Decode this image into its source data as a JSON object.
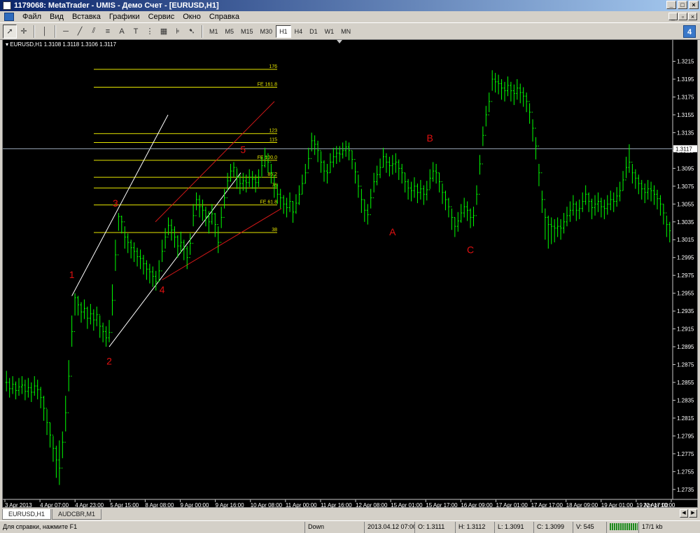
{
  "window": {
    "title": "1179068: MetaTrader - UMIS - Демо Счет - [EURUSD,H1]"
  },
  "menu": [
    "Файл",
    "Вид",
    "Вставка",
    "Графики",
    "Сервис",
    "Окно",
    "Справка"
  ],
  "toolbar": {
    "tools": [
      "cursor-icon",
      "crosshair-icon",
      "vertical-line-icon",
      "horizontal-line-icon",
      "trendline-icon",
      "equidistant-channel-icon",
      "text-icon",
      "text-label-icon",
      "fibonacci-icon",
      "fibonacci-fan-icon",
      "arrows-icon"
    ],
    "timeframes": [
      "M1",
      "M5",
      "M15",
      "M30",
      "H1",
      "H4",
      "D1",
      "W1",
      "MN"
    ],
    "active_timeframe": "H1",
    "text_tool_label": "A",
    "label_tool_label": "T",
    "help_label": "4"
  },
  "chart_data": {
    "type": "candlestick",
    "header": "EURUSD,H1  1.3108 1.3118 1.3106 1.3117",
    "background": "#000000",
    "bar_color": "#00ff00",
    "current_price": "1.3117",
    "y_ticks": [
      "1.3215",
      "1.3195",
      "1.3175",
      "1.3155",
      "1.3135",
      "1.3115",
      "1.3095",
      "1.3075",
      "1.3055",
      "1.3035",
      "1.3015",
      "1.2995",
      "1.2975",
      "1.2955",
      "1.2935",
      "1.2915",
      "1.2895",
      "1.2875",
      "1.2855",
      "1.2835",
      "1.2815",
      "1.2795",
      "1.2775",
      "1.2755",
      "1.2735"
    ],
    "y_range": [
      1.2727,
      1.3228
    ],
    "x_ticks": [
      "3 Apr 2013",
      "4 Apr 07:00",
      "4 Apr 23:00",
      "5 Apr 15:00",
      "8 Apr 08:00",
      "9 Apr 00:00",
      "9 Apr 16:00",
      "10 Apr 08:00",
      "11 Apr 00:00",
      "11 Apr 16:00",
      "12 Apr 08:00",
      "15 Apr 01:00",
      "15 Apr 17:00",
      "16 Apr 09:00",
      "17 Apr 01:00",
      "17 Apr 17:00",
      "18 Apr 09:00",
      "19 Apr 01:00",
      "19 Apr 17:00",
      "22 Apr 10:00"
    ],
    "closes": [
      1.2855,
      1.2848,
      1.2853,
      1.2846,
      1.285,
      1.2852,
      1.2845,
      1.2849,
      1.2844,
      1.2851,
      1.2847,
      1.2838,
      1.2826,
      1.281,
      1.2796,
      1.2781,
      1.2768,
      1.2759,
      1.2788,
      1.2821,
      1.2862,
      1.2912,
      1.295,
      1.2942,
      1.2934,
      1.2938,
      1.2927,
      1.2932,
      1.2925,
      1.2931,
      1.2918,
      1.2912,
      1.2905,
      1.2911,
      1.2947,
      1.2998,
      1.3041,
      1.3035,
      1.3018,
      1.3012,
      1.3006,
      1.3002,
      1.2996,
      1.2994,
      1.2988,
      1.2982,
      1.2979,
      1.2974,
      1.2968,
      1.298,
      1.3002,
      1.3018,
      1.3031,
      1.3026,
      1.3018,
      1.3008,
      1.3012,
      1.3005,
      1.2995,
      1.3011,
      1.3042,
      1.306,
      1.3052,
      1.3048,
      1.3041,
      1.3035,
      1.3044,
      1.3032,
      1.3012,
      1.304,
      1.3062,
      1.3081,
      1.3092,
      1.3096,
      1.3085,
      1.3078,
      1.3081,
      1.3079,
      1.3085,
      1.3083,
      1.3079,
      1.3085,
      1.3098,
      1.3108,
      1.3102,
      1.309,
      1.3075,
      1.3066,
      1.3062,
      1.3055,
      1.3051,
      1.3058,
      1.3046,
      1.3056,
      1.3066,
      1.3078,
      1.309,
      1.3106,
      1.3126,
      1.3122,
      1.3115,
      1.3102,
      1.3092,
      1.309,
      1.3102,
      1.3108,
      1.3112,
      1.3111,
      1.3115,
      1.3119,
      1.3115,
      1.3105,
      1.3091,
      1.3075,
      1.306,
      1.3048,
      1.3043,
      1.3062,
      1.308,
      1.3088,
      1.3096,
      1.3108,
      1.3102,
      1.3098,
      1.31,
      1.3102,
      1.3095,
      1.309,
      1.308,
      1.3073,
      1.307,
      1.3075,
      1.3068,
      1.3072,
      1.3066,
      1.3071,
      1.3084,
      1.3092,
      1.309,
      1.308,
      1.3068,
      1.306,
      1.3052,
      1.304,
      1.303,
      1.3036,
      1.3045,
      1.3052,
      1.3048,
      1.304,
      1.3042,
      1.3066,
      1.31,
      1.3132,
      1.3155,
      1.317,
      1.3195,
      1.3192,
      1.319,
      1.3185,
      1.3182,
      1.3188,
      1.3182,
      1.3179,
      1.3185,
      1.318,
      1.3176,
      1.317,
      1.3158,
      1.314,
      1.312,
      1.309,
      1.306,
      1.304,
      1.3032,
      1.303,
      1.3028,
      1.303,
      1.3028,
      1.3035,
      1.3042,
      1.3048,
      1.3055,
      1.3048,
      1.305,
      1.3058,
      1.3066,
      1.3058,
      1.3051,
      1.3055,
      1.3058,
      1.3052,
      1.305,
      1.3055,
      1.306,
      1.3058,
      1.3064,
      1.307,
      1.3082,
      1.3096,
      1.3102,
      1.309,
      1.3084,
      1.3078,
      1.3072,
      1.3068,
      1.3072,
      1.307,
      1.3066,
      1.3061,
      1.3055,
      1.3045,
      1.3032,
      1.3025
    ],
    "highs": [
      1.2868,
      1.286,
      1.2862,
      1.2856,
      1.286,
      1.2862,
      1.2858,
      1.286,
      1.2855,
      1.2862,
      1.2858,
      1.285,
      1.284,
      1.2825,
      1.281,
      1.2795,
      1.2784,
      1.279,
      1.28,
      1.284,
      1.288,
      1.293,
      1.2955,
      1.2952,
      1.2945,
      1.2948,
      1.294,
      1.2943,
      1.2937,
      1.294,
      1.293,
      1.2922,
      1.2918,
      1.2925,
      1.2965,
      1.3015,
      1.3045,
      1.3042,
      1.303,
      1.3022,
      1.3015,
      1.3012,
      1.3006,
      1.3004,
      1.2998,
      1.2992,
      1.2988,
      1.2985,
      1.298,
      1.2992,
      1.3015,
      1.3028,
      1.304,
      1.3038,
      1.303,
      1.302,
      1.3024,
      1.3015,
      1.3008,
      1.3022,
      1.3055,
      1.3068,
      1.3065,
      1.306,
      1.3052,
      1.3047,
      1.3055,
      1.3045,
      1.303,
      1.3052,
      1.3072,
      1.309,
      1.31,
      1.3102,
      1.3095,
      1.3088,
      1.309,
      1.3088,
      1.3094,
      1.3092,
      1.3088,
      1.3094,
      1.3108,
      1.3118,
      1.3112,
      1.31,
      1.3088,
      1.3078,
      1.3072,
      1.3065,
      1.3062,
      1.3068,
      1.3058,
      1.3066,
      1.3076,
      1.3088,
      1.31,
      1.3118,
      1.3135,
      1.3132,
      1.3126,
      1.3114,
      1.3104,
      1.31,
      1.3112,
      1.3118,
      1.312,
      1.312,
      1.3124,
      1.3126,
      1.3124,
      1.3115,
      1.3102,
      1.3088,
      1.3072,
      1.306,
      1.3055,
      1.3072,
      1.309,
      1.3098,
      1.3106,
      1.3118,
      1.3112,
      1.3108,
      1.311,
      1.3112,
      1.3105,
      1.31,
      1.309,
      1.3083,
      1.308,
      1.3085,
      1.3078,
      1.3082,
      1.3076,
      1.3081,
      1.3094,
      1.3102,
      1.31,
      1.309,
      1.3078,
      1.307,
      1.3062,
      1.305,
      1.304,
      1.3046,
      1.3055,
      1.3062,
      1.3058,
      1.305,
      1.3052,
      1.3076,
      1.311,
      1.3142,
      1.3165,
      1.318,
      1.3205,
      1.3202,
      1.32,
      1.3195,
      1.3192,
      1.3198,
      1.3192,
      1.3189,
      1.3195,
      1.319,
      1.3186,
      1.318,
      1.3168,
      1.315,
      1.313,
      1.31,
      1.307,
      1.305,
      1.3042,
      1.304,
      1.3038,
      1.304,
      1.3038,
      1.3045,
      1.3052,
      1.3058,
      1.3065,
      1.3058,
      1.306,
      1.3068,
      1.3076,
      1.3068,
      1.3061,
      1.3065,
      1.3068,
      1.3062,
      1.306,
      1.3065,
      1.307,
      1.3068,
      1.3074,
      1.308,
      1.3092,
      1.3108,
      1.3122,
      1.31,
      1.3094,
      1.3088,
      1.3082,
      1.3078,
      1.3082,
      1.308,
      1.3076,
      1.3071,
      1.3065,
      1.3055,
      1.3042,
      1.3035
    ],
    "lows": [
      1.2845,
      1.2838,
      1.2842,
      1.2836,
      1.284,
      1.2842,
      1.2835,
      1.2838,
      1.2833,
      1.284,
      1.2836,
      1.2826,
      1.2812,
      1.2796,
      1.2782,
      1.2766,
      1.2748,
      1.274,
      1.277,
      1.28,
      1.2845,
      1.2895,
      1.293,
      1.293,
      1.2922,
      1.2926,
      1.2915,
      1.292,
      1.2913,
      1.2918,
      1.2905,
      1.29,
      1.2895,
      1.29,
      1.293,
      1.298,
      1.3025,
      1.3022,
      1.3005,
      1.3,
      1.2994,
      1.299,
      1.2985,
      1.2982,
      1.2976,
      1.297,
      1.2966,
      1.2962,
      1.2958,
      1.2968,
      1.299,
      1.3005,
      1.302,
      1.3014,
      1.3006,
      1.2995,
      1.3,
      1.2992,
      1.2982,
      1.2998,
      1.303,
      1.3048,
      1.304,
      1.3036,
      1.303,
      1.3022,
      1.3032,
      1.3018,
      1.3,
      1.3028,
      1.305,
      1.307,
      1.308,
      1.3085,
      1.3072,
      1.3066,
      1.307,
      1.3068,
      1.3074,
      1.3072,
      1.3068,
      1.3074,
      1.3086,
      1.3096,
      1.309,
      1.3078,
      1.3062,
      1.3055,
      1.305,
      1.3044,
      1.304,
      1.3046,
      1.3034,
      1.3044,
      1.3054,
      1.3066,
      1.3078,
      1.3094,
      1.3114,
      1.311,
      1.3102,
      1.309,
      1.308,
      1.3078,
      1.309,
      1.3096,
      1.31,
      1.3102,
      1.3106,
      1.3108,
      1.3104,
      1.3094,
      1.3078,
      1.3062,
      1.3045,
      1.3035,
      1.3032,
      1.305,
      1.3068,
      1.3076,
      1.3084,
      1.3096,
      1.309,
      1.3086,
      1.3088,
      1.309,
      1.3082,
      1.3078,
      1.3068,
      1.306,
      1.3058,
      1.3062,
      1.3056,
      1.306,
      1.3054,
      1.3059,
      1.3072,
      1.308,
      1.3078,
      1.3068,
      1.3055,
      1.3048,
      1.304,
      1.3026,
      1.3018,
      1.3024,
      1.3034,
      1.304,
      1.3036,
      1.3028,
      1.303,
      1.3054,
      1.3088,
      1.312,
      1.3142,
      1.3158,
      1.3182,
      1.318,
      1.3178,
      1.3172,
      1.317,
      1.3176,
      1.317,
      1.3166,
      1.3172,
      1.3168,
      1.3164,
      1.3158,
      1.3145,
      1.3125,
      1.3105,
      1.3075,
      1.3045,
      1.3015,
      1.3005,
      1.301,
      1.3012,
      1.3018,
      1.3015,
      1.3022,
      1.303,
      1.3035,
      1.3042,
      1.3036,
      1.3038,
      1.3046,
      1.3054,
      1.3046,
      1.3038,
      1.3042,
      1.3046,
      1.304,
      1.3038,
      1.3043,
      1.3048,
      1.3046,
      1.3052,
      1.3058,
      1.307,
      1.3084,
      1.309,
      1.3078,
      1.3072,
      1.3066,
      1.306,
      1.3056,
      1.306,
      1.3058,
      1.3054,
      1.3049,
      1.3042,
      1.3032,
      1.3018,
      1.3012
    ],
    "fib_levels": [
      {
        "label": "176",
        "price": 1.3206
      },
      {
        "label": "FE 161.8",
        "price": 1.3186
      },
      {
        "label": "123",
        "price": 1.3134
      },
      {
        "label": "115",
        "price": 1.3124
      },
      {
        "label": "FE 100.0",
        "price": 1.3104
      },
      {
        "label": "85.2",
        "price": 1.3085
      },
      {
        "label": "76",
        "price": 1.3073
      },
      {
        "label": "FE 61.8",
        "price": 1.3054
      },
      {
        "label": "38",
        "price": 1.3023
      }
    ],
    "wave_labels": [
      {
        "text": "1",
        "bar": 21,
        "price": 1.2972
      },
      {
        "text": "2",
        "bar": 33,
        "price": 1.2875
      },
      {
        "text": "3",
        "bar": 35,
        "price": 1.3052
      },
      {
        "text": "4",
        "bar": 50,
        "price": 1.2955
      },
      {
        "text": "5",
        "bar": 76,
        "price": 1.3112
      },
      {
        "text": "A",
        "bar": 124,
        "price": 1.302
      },
      {
        "text": "B",
        "bar": 136,
        "price": 1.3125
      },
      {
        "text": "C",
        "bar": 149,
        "price": 1.3
      }
    ],
    "wave_label_color": "#e01010"
  },
  "tabs": [
    "EURUSD,H1",
    "AUDCBR,M1"
  ],
  "active_tab": "EURUSD,H1",
  "status": {
    "help": "Для справки, нажмите F1",
    "profile": "Down",
    "datetime": "2013.04.12 07:00",
    "open": "O: 1.3111",
    "high": "H: 1.3112",
    "low": "L: 1.3091",
    "close": "C: 1.3099",
    "volume": "V: 545",
    "traffic": "17/1 kb"
  }
}
